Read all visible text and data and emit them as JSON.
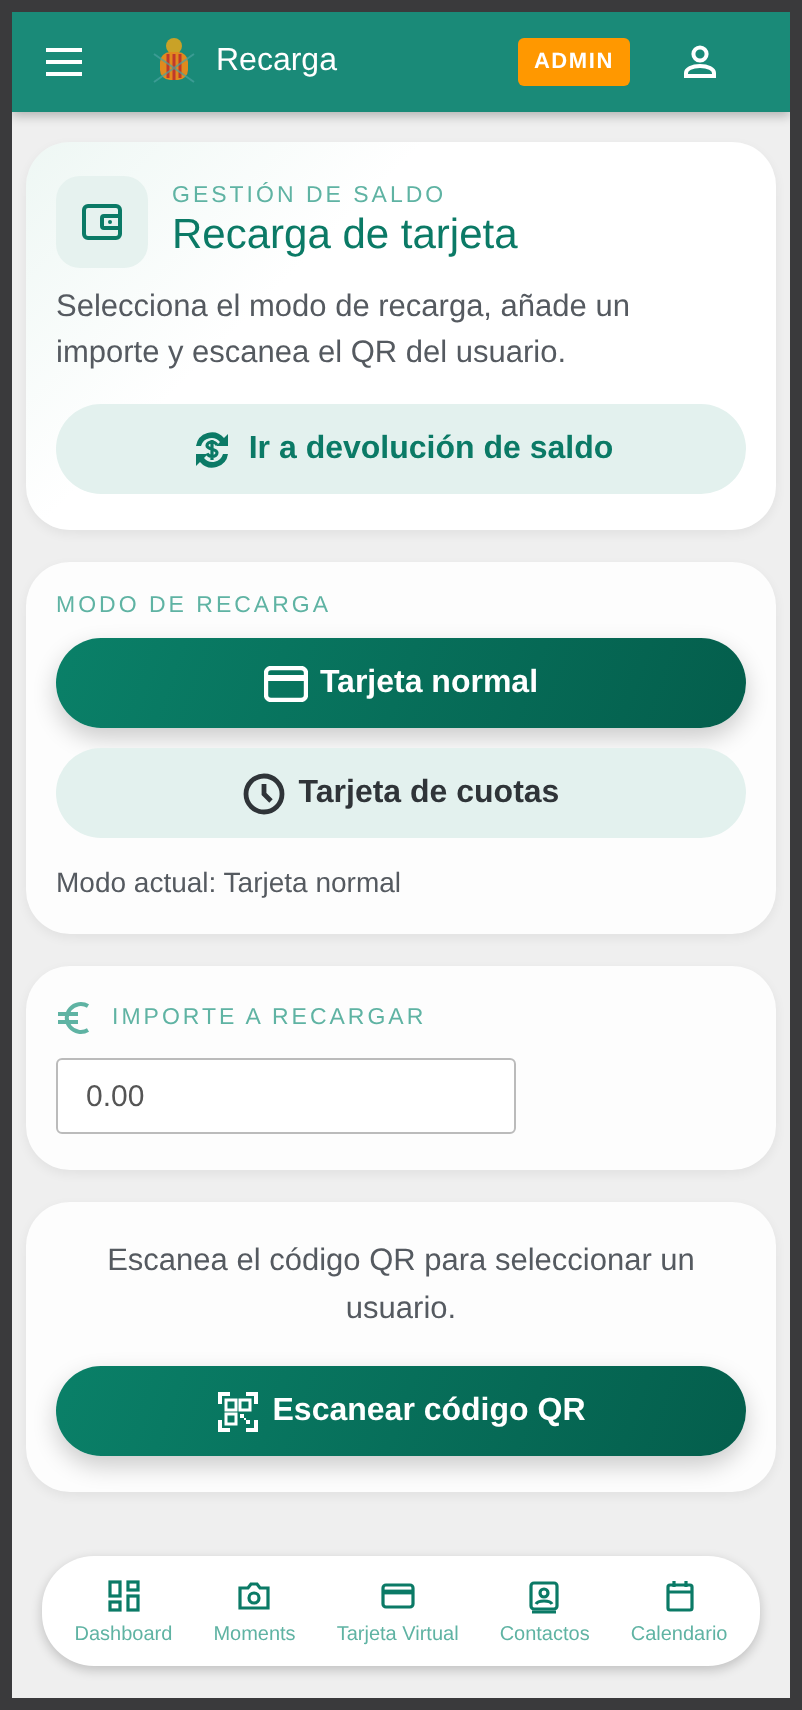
{
  "header": {
    "title": "Recarga",
    "badge": "ADMIN"
  },
  "intro": {
    "eyebrow": "GESTIÓN DE SALDO",
    "title": "Recarga de tarjeta",
    "description": "Selecciona el modo de recarga, añade un importe y escanea el QR del usuario.",
    "action": "Ir a devolución de saldo"
  },
  "mode": {
    "heading": "MODO DE RECARGA",
    "options": [
      {
        "label": "Tarjeta normal",
        "kind": "card",
        "selected": true
      },
      {
        "label": "Tarjeta de cuotas",
        "kind": "clock",
        "selected": false
      }
    ],
    "current": "Modo actual: Tarjeta normal"
  },
  "amount": {
    "heading": "IMPORTE A RECARGAR",
    "placeholder": "0.00"
  },
  "scan": {
    "text": "Escanea el código QR para seleccionar un usuario.",
    "button": "Escanear código QR"
  },
  "nav": [
    {
      "label": "Dashboard",
      "kind": "dashboard"
    },
    {
      "label": "Moments",
      "kind": "camera"
    },
    {
      "label": "Tarjeta Virtual",
      "kind": "card"
    },
    {
      "label": "Contactos",
      "kind": "contact"
    },
    {
      "label": "Calendario",
      "kind": "calendar"
    }
  ]
}
